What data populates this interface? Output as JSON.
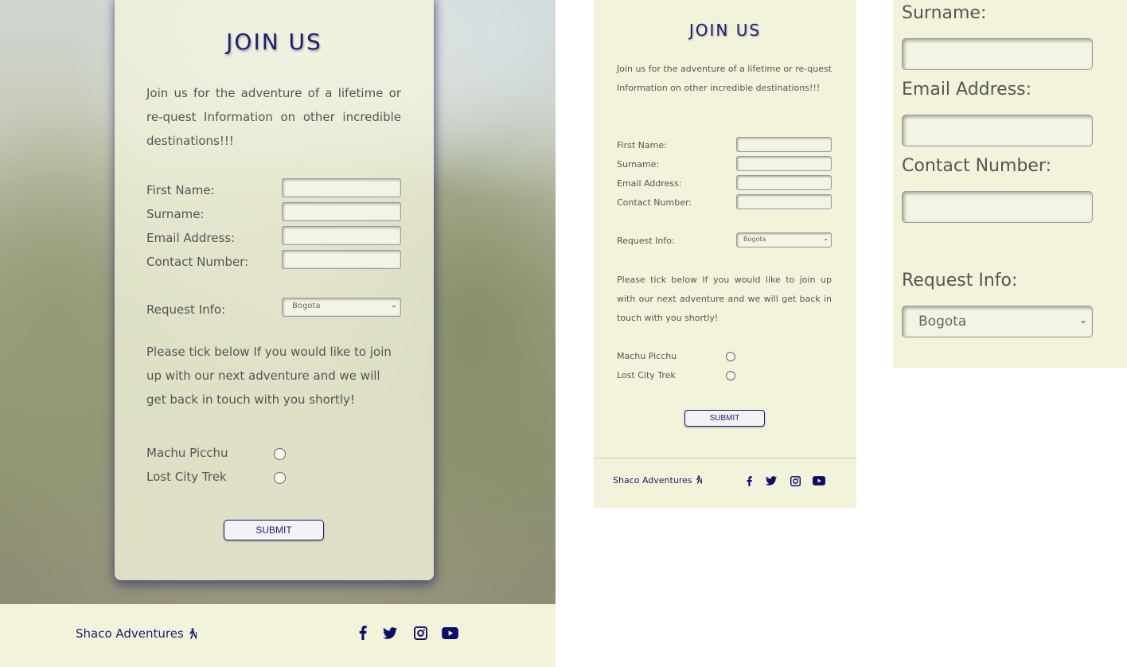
{
  "form": {
    "title": "JOIN US",
    "intro": "Join us for the adventure of a lifetime or re-quest Information on other incredible destinations!!!",
    "fields": {
      "first_name": "First Name:",
      "surname": "Surname:",
      "email": "Email Address:",
      "contact": "Contact Number:"
    },
    "request_info": {
      "label": "Request Info:",
      "selected": "Bogota"
    },
    "tick_text": "Please tick below If you would like to join up with our next adventure and we will get back in touch with you shortly!",
    "options": [
      "Machu Picchu",
      "Lost City Trek"
    ],
    "submit_label": "SUBMIT"
  },
  "footer": {
    "brand": "Shaco Adventures",
    "brand_icon": "hiking-icon",
    "social_icons": [
      "facebook-icon",
      "twitter-icon",
      "instagram-icon",
      "youtube-icon"
    ]
  },
  "colors": {
    "accent": "#1e1e78",
    "panel_bg": "#f3f3dc",
    "text": "#555555"
  }
}
